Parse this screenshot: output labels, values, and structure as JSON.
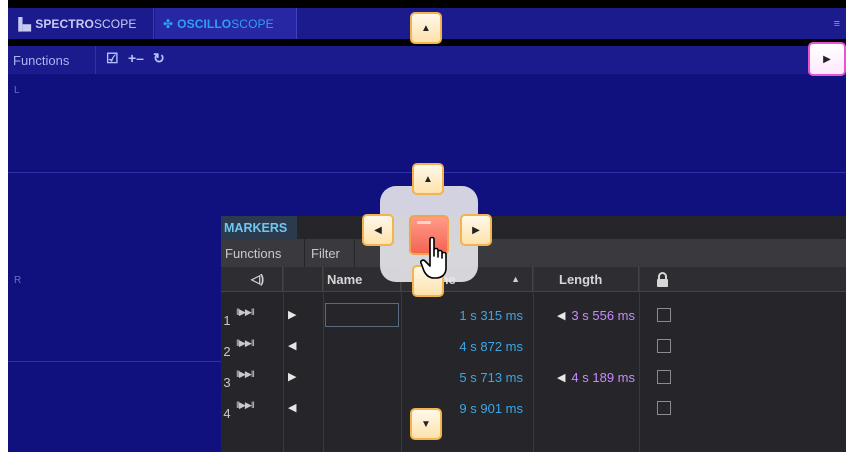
{
  "tabs": {
    "spectroscope": {
      "bold": "SPECTRO",
      "rest": "SCOPE"
    },
    "oscilloscope": {
      "bold": "OSCILLO",
      "rest": "SCOPE"
    }
  },
  "scope_toolbar": {
    "functions_label": "Functions"
  },
  "channels": {
    "left": "L",
    "right": "R"
  },
  "markers": {
    "tab_label": "MARKERS",
    "toolbar": {
      "functions_label": "Functions",
      "filter_label": "Filter"
    },
    "columns": {
      "name": "Name",
      "time": "me",
      "length": "Length"
    },
    "rows": [
      {
        "num": "1",
        "direction": "right",
        "time": "1 s 315 ms",
        "length": "3 s 556 ms"
      },
      {
        "num": "2",
        "direction": "left",
        "time": "4 s 872 ms",
        "length": ""
      },
      {
        "num": "3",
        "direction": "right",
        "time": "5 s 713 ms",
        "length": "4 s 189 ms"
      },
      {
        "num": "4",
        "direction": "left",
        "time": "9 s 901 ms",
        "length": ""
      }
    ]
  },
  "colors": {
    "tab_bar": "#1b1b8e",
    "scope_bg": "#10107f",
    "oscilloscope_accent": "#2fa0ef",
    "time_text": "#3aa7e8",
    "length_text": "#c889ff",
    "drag_button_border": "#f3b34e",
    "pink_button_border": "#e457d1"
  }
}
